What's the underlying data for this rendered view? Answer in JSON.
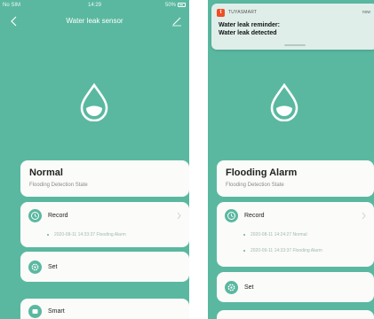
{
  "left_screen": {
    "status_bar": {
      "carrier": "No SIM",
      "time": "14:29",
      "battery": "50%"
    },
    "nav": {
      "title": "Water leak sensor"
    },
    "state": {
      "title": "Normal",
      "subtitle": "Flooding Detection State"
    },
    "record": {
      "label": "Record",
      "entries": [
        "2020-08-11 14:33:37 Flooding Alarm"
      ]
    },
    "set": {
      "label": "Set"
    },
    "smart": {
      "label": "Smart"
    }
  },
  "right_screen": {
    "notification": {
      "app_name": "TUYASMART",
      "time": "now",
      "title": "Water leak reminder:",
      "body": "Water leak detected"
    },
    "state": {
      "title": "Flooding Alarm",
      "subtitle": "Flooding Detection State"
    },
    "record": {
      "label": "Record",
      "entries": [
        "2020-08-11 14:24:27 Normal",
        "2020-09-11 14:33:37 Flooding Alarm"
      ]
    },
    "set": {
      "label": "Set"
    }
  },
  "colors": {
    "accent": "#5ab8a0",
    "card": "#fbfbf9",
    "notification_icon": "#f04e23"
  },
  "icons": [
    "back-icon",
    "edit-icon",
    "droplet-icon",
    "clock-icon",
    "gear-icon",
    "smart-icon",
    "chevron-right-icon"
  ]
}
